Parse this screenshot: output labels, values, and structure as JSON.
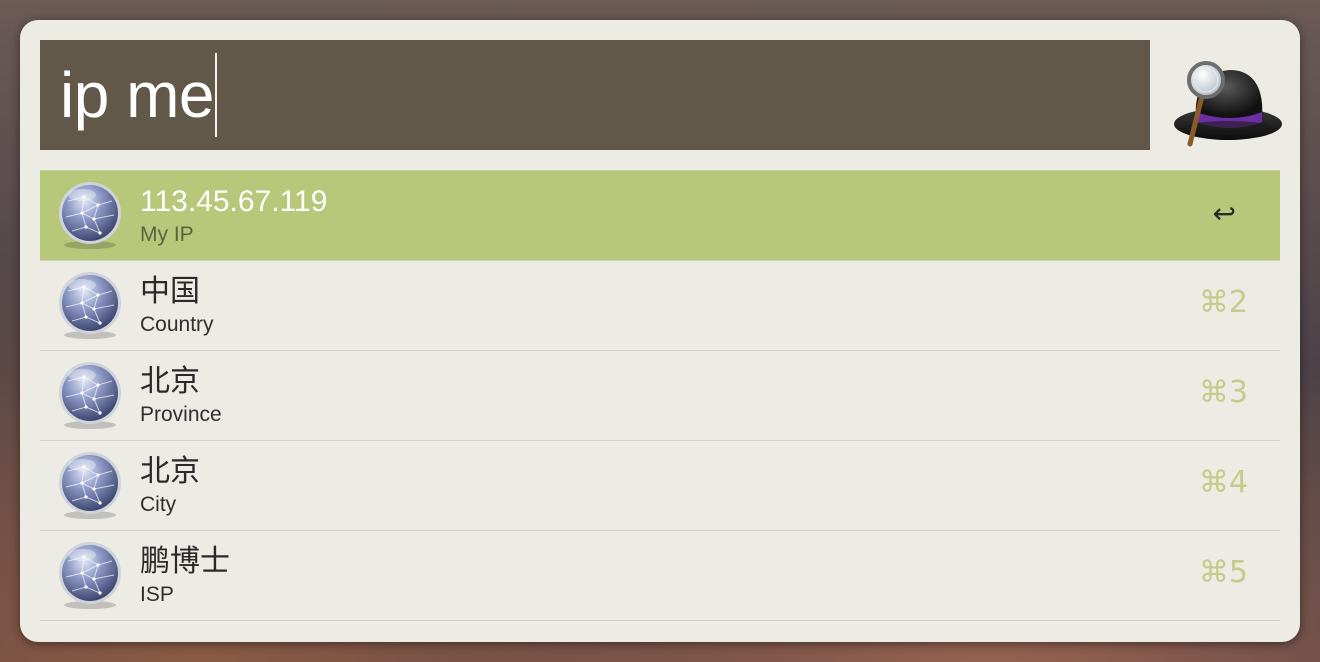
{
  "search": {
    "query": "ip me"
  },
  "app": {
    "logo_icon": "alfred-hat-icon"
  },
  "results": [
    {
      "title": "113.45.67.119",
      "subtitle": "My IP",
      "shortcut": "↩",
      "icon": "globe-icon",
      "selected": true
    },
    {
      "title": "中国",
      "subtitle": "Country",
      "shortcut": "⌘2",
      "icon": "globe-icon",
      "selected": false
    },
    {
      "title": "北京",
      "subtitle": "Province",
      "shortcut": "⌘3",
      "icon": "globe-icon",
      "selected": false
    },
    {
      "title": "北京",
      "subtitle": "City",
      "shortcut": "⌘4",
      "icon": "globe-icon",
      "selected": false
    },
    {
      "title": "鹏博士",
      "subtitle": "ISP",
      "shortcut": "⌘5",
      "icon": "globe-icon",
      "selected": false
    }
  ],
  "colors": {
    "panel_background": "#ecebe4",
    "search_background": "#615849",
    "selection_background": "#b7c87a",
    "shortcut_color": "#c3cd8a"
  }
}
